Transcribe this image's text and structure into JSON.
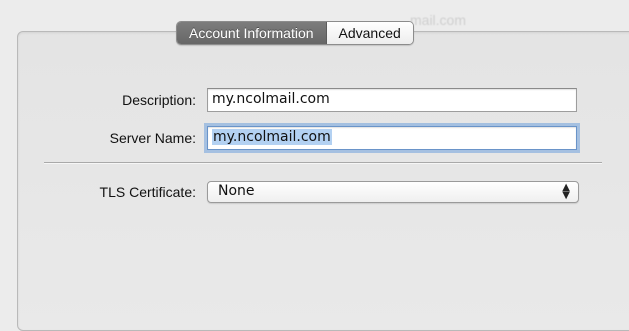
{
  "tabs": [
    {
      "label": "Account Information",
      "active": true
    },
    {
      "label": "Advanced",
      "active": false
    }
  ],
  "form": {
    "description_label": "Description:",
    "description_value": "my.ncolmail.com",
    "server_name_label": "Server Name:",
    "server_name_value": "my.ncolmail.com",
    "tls_label": "TLS Certificate:",
    "tls_value": "None"
  },
  "icons": {
    "popup_arrows": "up-down-chevron-icon"
  },
  "colors": {
    "active_tab": "#727272",
    "focus_ring": "#6fa0dc",
    "selection": "#b3d1f2"
  }
}
